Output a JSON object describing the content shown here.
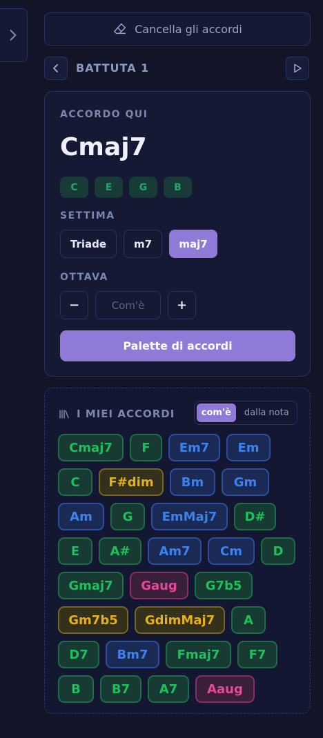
{
  "header": {
    "clear_label": "Cancella gli accordi",
    "bar_label": "BATTUTA 1"
  },
  "chord_card": {
    "here_label": "ACCORDO QUI",
    "chord_name": "Cmaj7",
    "notes": [
      "C",
      "E",
      "G",
      "B"
    ],
    "seventh_label": "SETTIMA",
    "seventh_options": [
      "Triade",
      "m7",
      "maj7"
    ],
    "seventh_selected": "maj7",
    "octave_label": "OTTAVA",
    "octave_minus": "−",
    "octave_value_placeholder": "Com'è",
    "octave_plus": "+",
    "palette_label": "Palette di accordi"
  },
  "my_chords": {
    "title": "I MIEI ACCORDI",
    "toggle_active": "com'è",
    "toggle_inactive": "dalla nota",
    "rows": [
      [
        {
          "label": "Cmaj7",
          "color": "green"
        },
        {
          "label": "F",
          "color": "green"
        },
        {
          "label": "Em7",
          "color": "blue"
        },
        {
          "label": "Em",
          "color": "blue"
        }
      ],
      [
        {
          "label": "C",
          "color": "green"
        },
        {
          "label": "F#dim",
          "color": "yellow"
        },
        {
          "label": "Bm",
          "color": "blue"
        },
        {
          "label": "Gm",
          "color": "blue"
        }
      ],
      [
        {
          "label": "Am",
          "color": "blue"
        },
        {
          "label": "G",
          "color": "green"
        },
        {
          "label": "EmMaj7",
          "color": "blue"
        },
        {
          "label": "D#",
          "color": "green"
        }
      ],
      [
        {
          "label": "E",
          "color": "green"
        },
        {
          "label": "A#",
          "color": "green"
        },
        {
          "label": "Am7",
          "color": "blue"
        },
        {
          "label": "Cm",
          "color": "blue"
        },
        {
          "label": "D",
          "color": "green"
        }
      ],
      [
        {
          "label": "Gmaj7",
          "color": "green"
        },
        {
          "label": "Gaug",
          "color": "pink"
        },
        {
          "label": "G7b5",
          "color": "green"
        }
      ],
      [
        {
          "label": "Gm7b5",
          "color": "yellow"
        },
        {
          "label": "GdimMaj7",
          "color": "yellow"
        },
        {
          "label": "A",
          "color": "green"
        }
      ],
      [
        {
          "label": "D7",
          "color": "green"
        },
        {
          "label": "Bm7",
          "color": "blue"
        },
        {
          "label": "Fmaj7",
          "color": "green"
        },
        {
          "label": "F7",
          "color": "green"
        }
      ],
      [
        {
          "label": "B",
          "color": "green"
        },
        {
          "label": "B7",
          "color": "green"
        },
        {
          "label": "A7",
          "color": "green"
        },
        {
          "label": "Aaug",
          "color": "pink"
        }
      ]
    ]
  }
}
